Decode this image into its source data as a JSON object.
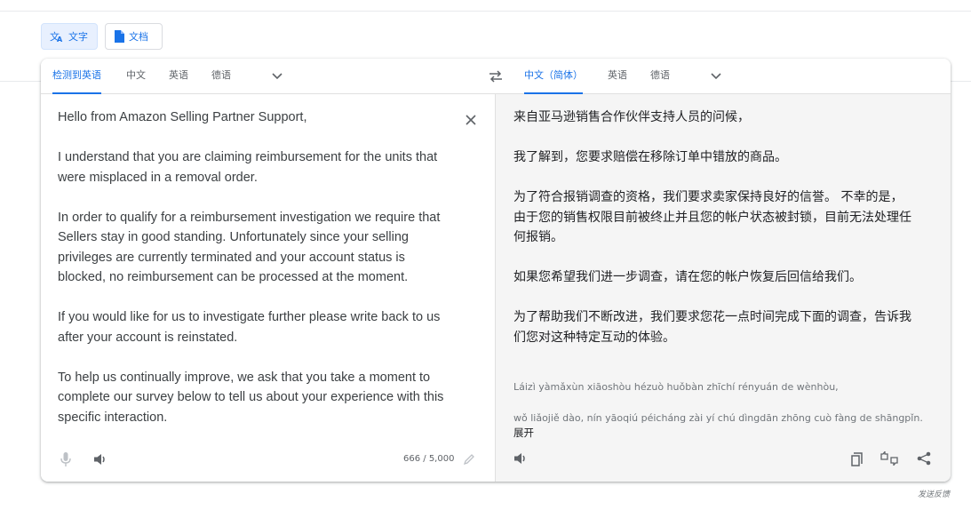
{
  "mode_buttons": {
    "text_label": "文字",
    "docs_label": "文档"
  },
  "source_langs": {
    "detect": "检测到英语",
    "lang1": "中文",
    "lang2": "英语",
    "lang3": "德语"
  },
  "target_langs": {
    "lang1": "中文（简体）",
    "lang2": "英语",
    "lang3": "德语"
  },
  "source": {
    "text": "Hello from Amazon Selling Partner Support,\n\nI understand that you are claiming reimbursement for the units that were misplaced in a removal order.\n\nIn order to qualify for a reimbursement investigation we require that Sellers stay in good standing. Unfortunately since your selling privileges are currently terminated and your account status is blocked, no reimbursement can be processed at the moment.\n\nIf you would like for us to investigate further please write back to us after your account is reinstated.\n\nTo help us continually improve, we ask that you take a moment to complete our survey below to tell us about your experience with this specific interaction.",
    "char_count": "666 / 5,000"
  },
  "target": {
    "text": "来自亚马逊销售合作伙伴支持人员的问候，\n\n我了解到，您要求赔偿在移除订单中错放的商品。\n\n为了符合报销调查的资格，我们要求卖家保持良好的信誉。 不幸的是，由于您的销售权限目前被终止并且您的帐户状态被封锁，目前无法处理任何报销。\n\n如果您希望我们进一步调查，请在您的帐户恢复后回信给我们。\n\n为了帮助我们不断改进，我们要求您花一点时间完成下面的调查，告诉我们您对这种特定互动的体验。",
    "transliteration": "Láizì yàmǎxùn xiāoshòu hézuò huǒbàn zhīchí rényuán de wènhòu,\nwǒ liǎojiě dào, nín yāoqiú péicháng zài yí chú dìngdān zhōng cuò fàng de shāngpǐn.",
    "expand_label": "展开"
  },
  "footer": {
    "feedback": "发送反馈"
  },
  "colors": {
    "accent": "#1a73e8",
    "target_bg": "#f5f5f5"
  }
}
